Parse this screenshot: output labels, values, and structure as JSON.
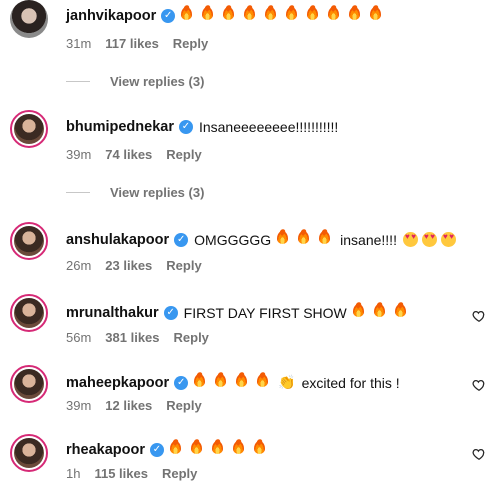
{
  "comments": [
    {
      "username": "janhvikapoor",
      "text": "",
      "fires": 10,
      "after_text": "",
      "hearts": 0,
      "time": "31m",
      "likes": "117 likes",
      "reply": "Reply"
    },
    {
      "username": "bhumipednekar",
      "text": "Insaneeeeeeee!!!!!!!!!!!",
      "fires": 0,
      "after_text": "",
      "hearts": 0,
      "time": "39m",
      "likes": "74 likes",
      "reply": "Reply"
    },
    {
      "username": "anshulakapoor",
      "text": "OMGGGGG",
      "fires": 3,
      "after_text": "insane!!!!",
      "hearts": 3,
      "time": "26m",
      "likes": "23 likes",
      "reply": "Reply"
    },
    {
      "username": "mrunalthakur",
      "text": "FIRST DAY FIRST SHOW",
      "fires": 3,
      "after_text": "",
      "hearts": 0,
      "time": "56m",
      "likes": "381 likes",
      "reply": "Reply"
    },
    {
      "username": "maheepkapoor",
      "text": "",
      "fires": 4,
      "after_text": "excited for this !",
      "hearts": 0,
      "time": "39m",
      "likes": "12 likes",
      "reply": "Reply"
    },
    {
      "username": "rheakapoor",
      "text": "",
      "fires": 5,
      "after_text": "",
      "hearts": 0,
      "time": "1h",
      "likes": "115 likes",
      "reply": "Reply"
    }
  ],
  "view_replies": [
    "View replies (3)",
    "View replies (3)"
  ],
  "icons": {
    "verified": "verified-badge-icon",
    "like": "heart-outline-icon",
    "fire": "fire-emoji-icon",
    "heart_eyes": "heart-eyes-emoji-icon",
    "clap": "clap-emoji-icon"
  },
  "colors": {
    "verified": "#3897f0",
    "meta": "#737373",
    "ring": "#d62976"
  }
}
